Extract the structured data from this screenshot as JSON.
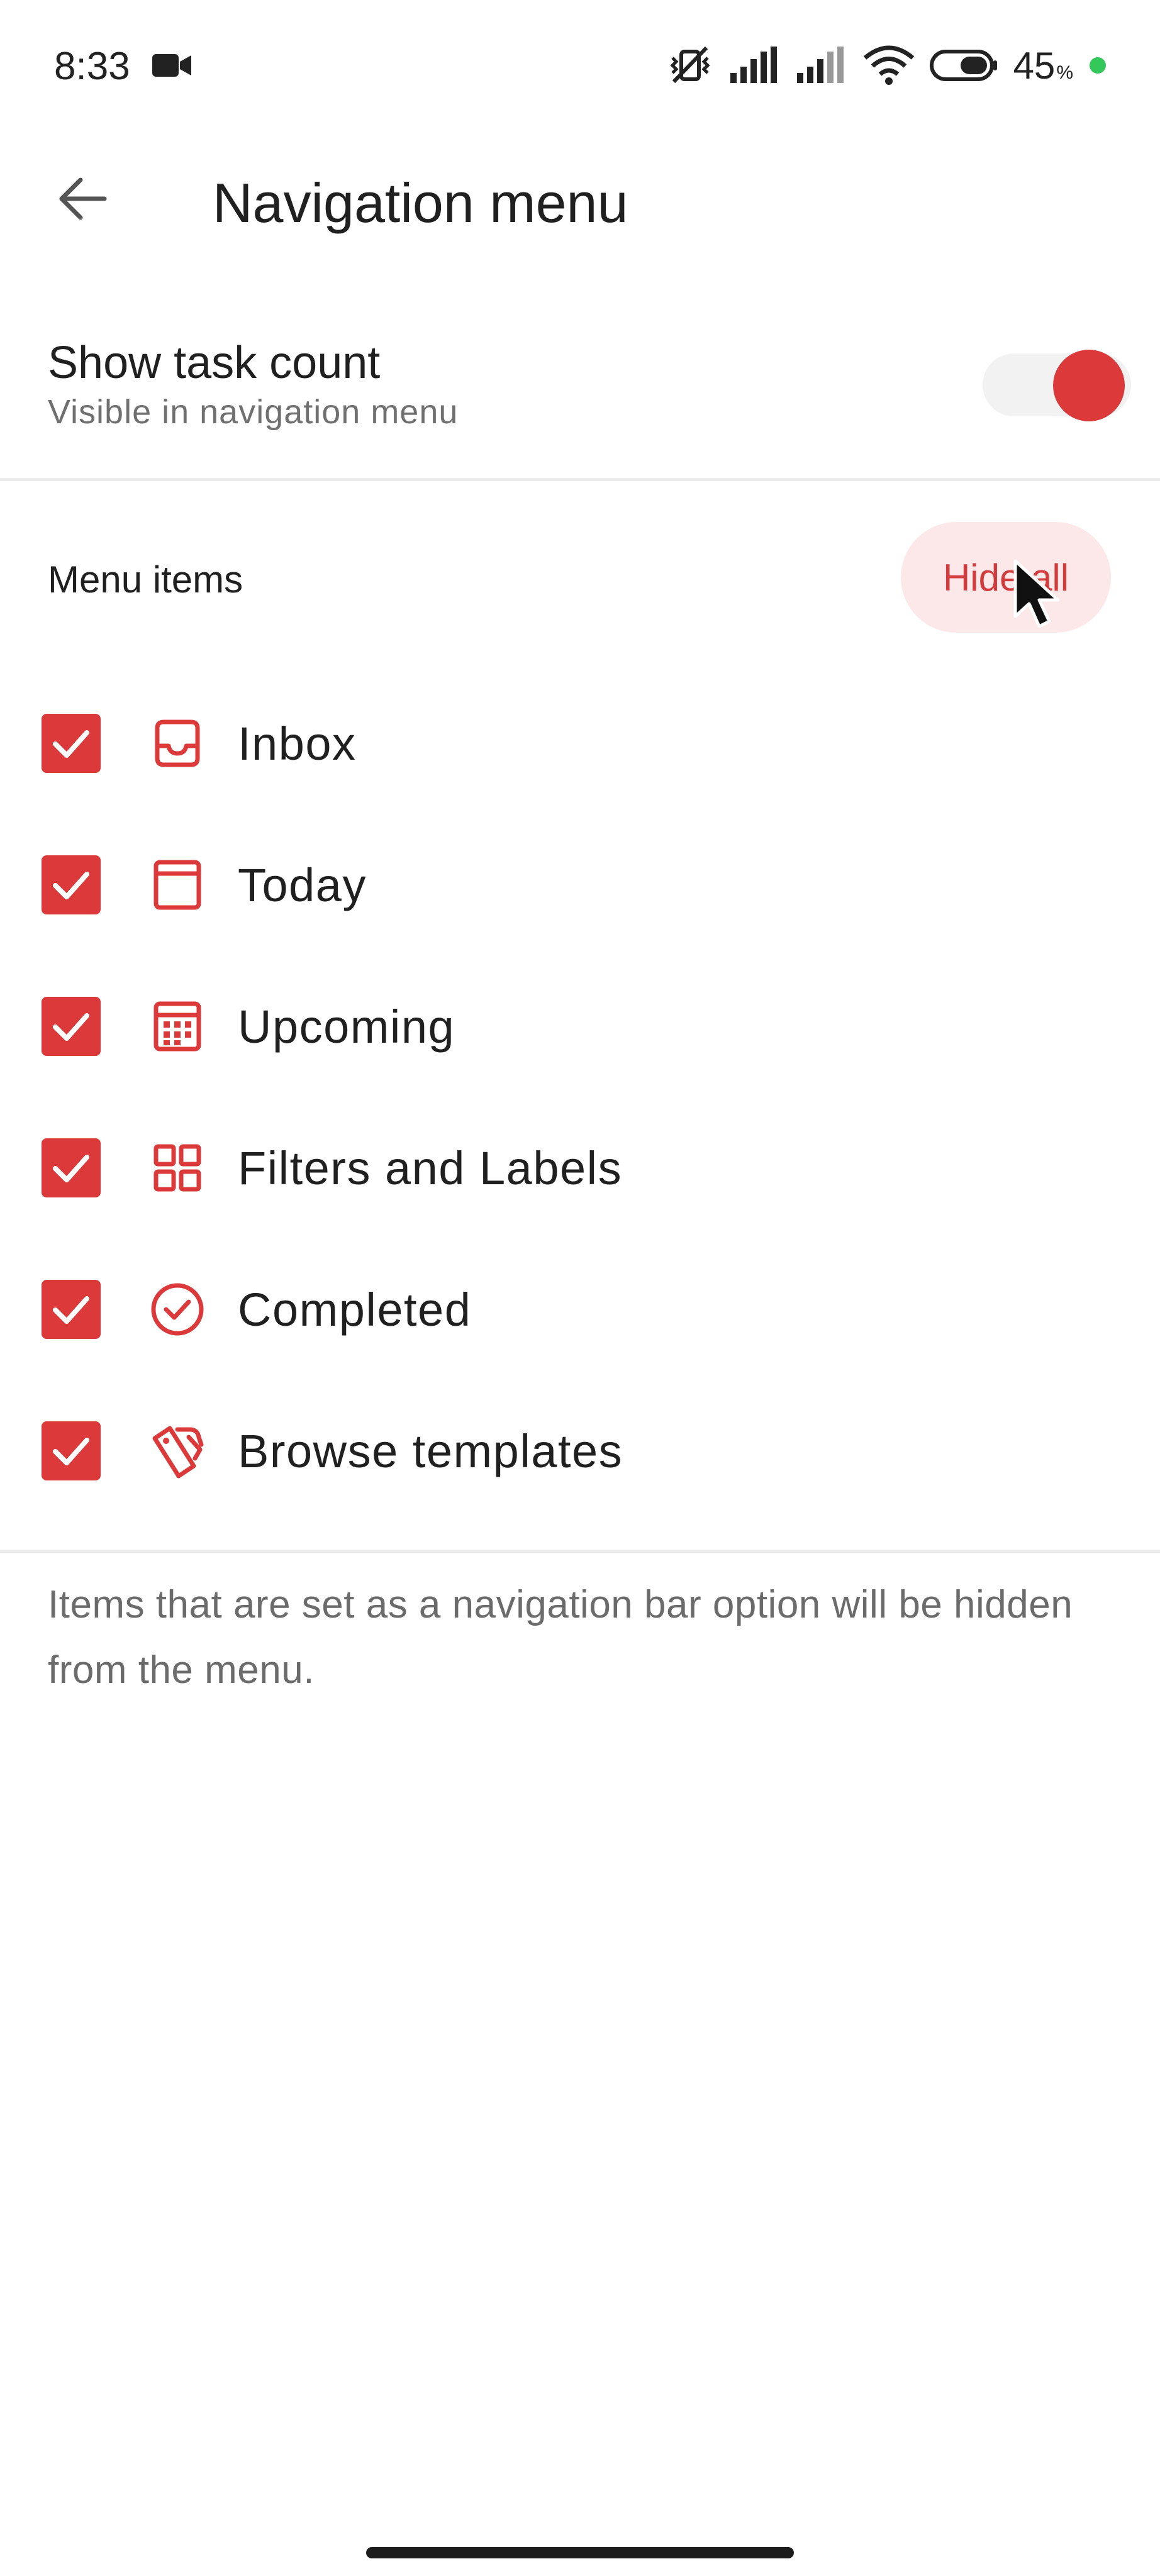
{
  "status_bar": {
    "time": "8:33",
    "battery_percent": "45",
    "battery_suffix": "%",
    "icons": [
      "video-camera-icon",
      "muted-vibrate-icon",
      "signal-icon",
      "signal-icon",
      "wifi-icon",
      "battery-icon",
      "green-dot-indicator"
    ]
  },
  "app_bar": {
    "back_icon": "arrow-left-icon",
    "title": "Navigation menu"
  },
  "task_count": {
    "title": "Show task count",
    "subtitle": "Visible in navigation menu",
    "enabled": true
  },
  "menu_section": {
    "label": "Menu items",
    "hide_all_label": "Hide all",
    "items": [
      {
        "label": "Inbox",
        "icon": "inbox-icon",
        "checked": true
      },
      {
        "label": "Today",
        "icon": "today-icon",
        "checked": true
      },
      {
        "label": "Upcoming",
        "icon": "calendar-icon",
        "checked": true
      },
      {
        "label": "Filters and Labels",
        "icon": "grid-icon",
        "checked": true
      },
      {
        "label": "Completed",
        "icon": "check-circle-icon",
        "checked": true
      },
      {
        "label": "Browse templates",
        "icon": "templates-icon",
        "checked": true
      }
    ]
  },
  "footer": {
    "note": "Items that are set as a navigation bar option will be hidden from the menu."
  },
  "colors": {
    "accent": "#dc3a3a",
    "accent_light": "#fce8e8",
    "text_primary": "#202020",
    "text_secondary": "#707070",
    "divider": "#ececec"
  }
}
